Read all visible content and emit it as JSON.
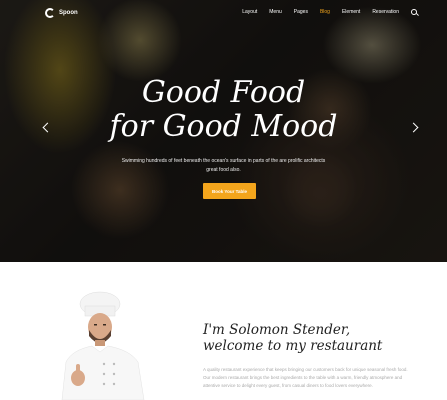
{
  "nav": {
    "logo_text": "Spoon",
    "items": [
      "Layout",
      "Menu",
      "Pages",
      "Blog",
      "Element",
      "Reservation"
    ],
    "active_index": 3
  },
  "hero": {
    "title_line1": "Good Food",
    "title_line2": "for Good Mood",
    "subtitle": "Swimming hundreds of feet beneath the ocean's surface in parts of the are prolific architects great food also.",
    "button_label": "Book Your Table"
  },
  "about": {
    "title_line1": "I'm Solomon Stender,",
    "title_line2": "welcome to my restaurant",
    "text": "A quality restaurant experience that keeps bringing our customers back for unique seasonal fresh food. Our modern restaurant brings the best ingredients to the table with a warm, friendly atmosphere and attentive service to delight every guest, from casual diners to food lovers everywhere."
  },
  "colors": {
    "accent": "#f3a51c"
  }
}
